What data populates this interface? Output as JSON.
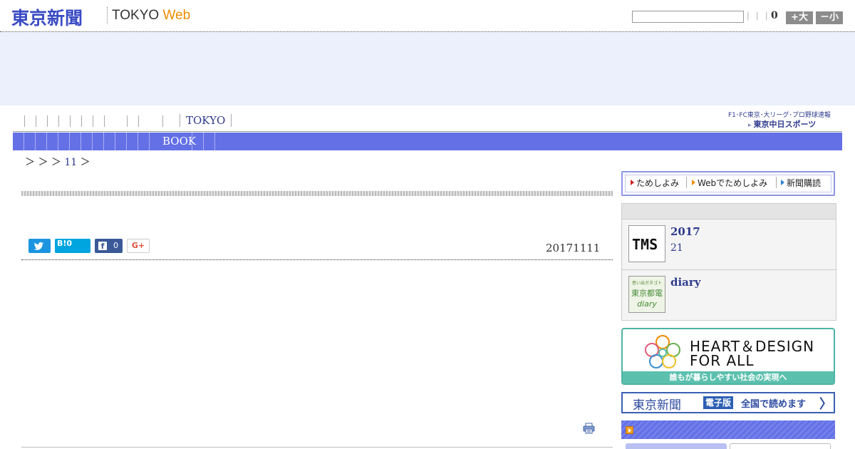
{
  "header": {
    "logo_jp": "東京新聞",
    "logo_tokyo": "TOKYO",
    "logo_web": "Web",
    "search": {
      "value": "",
      "placeholder": ""
    },
    "separators": "| | |",
    "font_size_value": "0",
    "bigger_label": "+大",
    "smaller_label": "－小"
  },
  "nav": {
    "tokyo_label": "TOKYO",
    "book_label": "BOOK",
    "chunichi_top": "F1･FC東京･大リーグ･プロ野球速報",
    "chunichi_bottom": "東京中日スポーツ"
  },
  "breadcrumb": {
    "prefix": "＞ ＞ ＞",
    "link": "11",
    "suffix": "＞"
  },
  "article": {
    "date": "20171111",
    "share": {
      "hatena_label": "B!",
      "hatena_count": "0",
      "facebook_count": "0",
      "gplus_label": "G+"
    }
  },
  "sidebar": {
    "trial": {
      "item1": "ためしよみ",
      "item2": "Webでためしよみ",
      "item3": "新聞購読"
    },
    "items": [
      {
        "title": "2017",
        "sub": "21",
        "thumb": "TMS"
      },
      {
        "title": "diary",
        "sub": "",
        "thumb_top": "思い出ガタゴト",
        "thumb_mid": "東京都電",
        "thumb_bottom": "diary"
      }
    ],
    "heart_design": {
      "line1": "HEART＆DESIGN",
      "line2": "FOR ALL",
      "footer": "誰もが暮らしやすい社会の実現へ"
    },
    "epaper": {
      "logo": "東京新聞",
      "badge": "電子版",
      "text": "全国で読めます",
      "arrow": "〉"
    }
  },
  "colors": {
    "brand_blue": "#3a4bc4",
    "nav_blue": "#6470e6",
    "ad_band": "#ebf0fc",
    "web_orange": "#f08c00",
    "hd_teal": "#5cc0ae"
  }
}
